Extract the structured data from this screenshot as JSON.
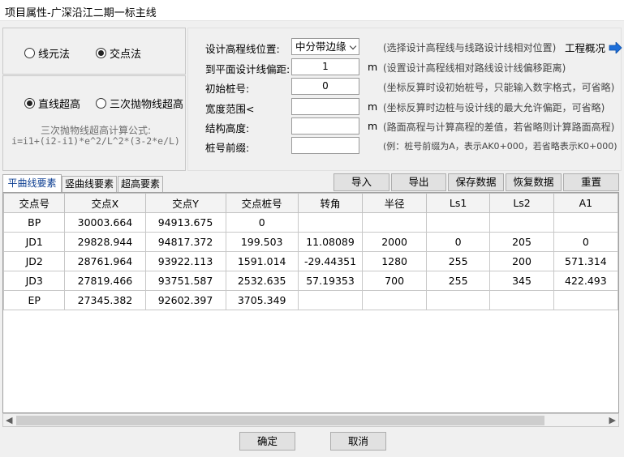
{
  "window": {
    "title": "项目属性-广深沿江二期一标主线"
  },
  "method": {
    "options": [
      "线元法",
      "交点法"
    ],
    "selected": "交点法"
  },
  "superelevation": {
    "options": [
      "直线超高",
      "三次抛物线超高"
    ],
    "selected": "直线超高",
    "formula_title": "三次抛物线超高计算公式:",
    "formula": "i=i1+(i2-i1)*e^2/L^2*(3-2*e/L)"
  },
  "settings": {
    "design_line_label": "设计高程线位置:",
    "design_line_value": "中分带边缘",
    "design_line_hint": "(选择设计高程线与线路设计线相对位置)",
    "project_overview": "工程概况",
    "offset_label": "到平面设计线偏距:",
    "offset_value": "1",
    "offset_unit": "m",
    "offset_hint": "(设置设计高程线相对路线设计线偏移距离)",
    "start_station_label": "初始桩号:",
    "start_station_value": "0",
    "start_station_hint": "(坐标反算时设初始桩号，只能输入数字格式，可省略)",
    "width_label": "宽度范围<",
    "width_value": "",
    "width_unit": "m",
    "width_hint": "(坐标反算时边桩与设计线的最大允许偏距，可省略)",
    "struct_label": "结构高度:",
    "struct_value": "",
    "struct_unit": "m",
    "struct_hint": "(路面高程与计算高程的差值，若省略则计算路面高程)",
    "prefix_label": "桩号前缀:",
    "prefix_value": "",
    "prefix_hint": "(例：桩号前缀为A，表示AK0+000，若省略表示K0+000)"
  },
  "tabs": [
    "平曲线要素",
    "竖曲线要素",
    "超高要素"
  ],
  "toolbar": {
    "import": "导入",
    "export": "导出",
    "save": "保存数据",
    "restore": "恢复数据",
    "reset": "重置"
  },
  "table": {
    "columns": [
      "交点号",
      "交点X",
      "交点Y",
      "交点桩号",
      "转角",
      "半径",
      "Ls1",
      "Ls2",
      "A1"
    ],
    "rows": [
      [
        "BP",
        "30003.664",
        "94913.675",
        "0",
        "",
        "",
        "",
        "",
        ""
      ],
      [
        "JD1",
        "29828.944",
        "94817.372",
        "199.503",
        "11.08089",
        "2000",
        "0",
        "205",
        "0"
      ],
      [
        "JD2",
        "28761.964",
        "93922.113",
        "1591.014",
        "-29.44351",
        "1280",
        "255",
        "200",
        "571.314"
      ],
      [
        "JD3",
        "27819.466",
        "93751.587",
        "2532.635",
        "57.19353",
        "700",
        "255",
        "345",
        "422.493"
      ],
      [
        "EP",
        "27345.382",
        "92602.397",
        "3705.349",
        "",
        "",
        "",
        "",
        ""
      ]
    ]
  },
  "footer": {
    "ok": "确定",
    "cancel": "取消"
  }
}
